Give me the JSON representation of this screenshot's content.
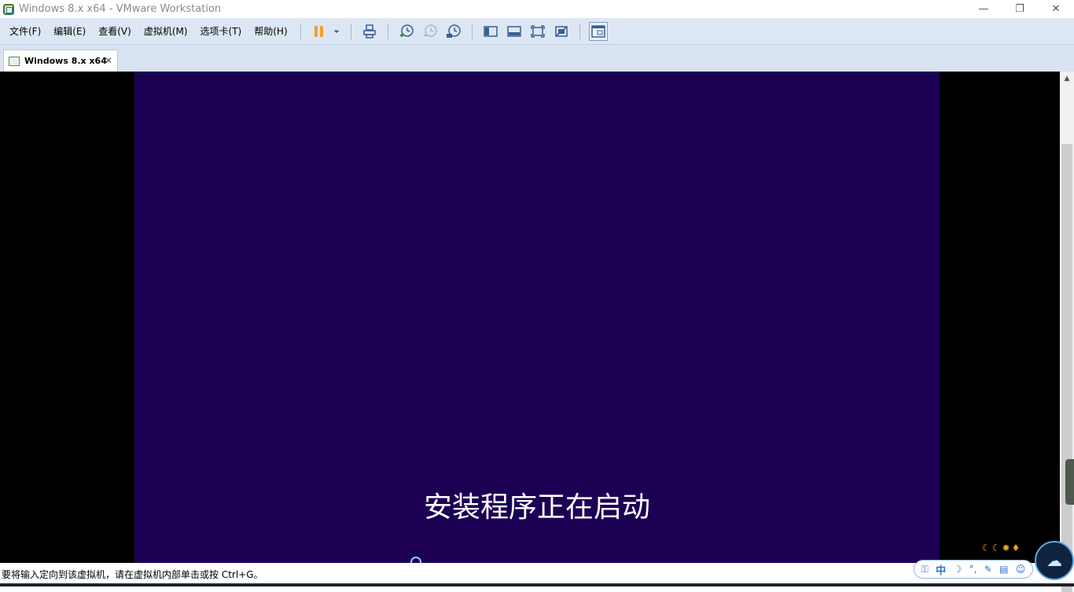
{
  "window": {
    "title": "Windows 8.x x64 - VMware Workstation",
    "minimize_glyph": "—",
    "restore_glyph": "❐",
    "close_glyph": "✕"
  },
  "menu": {
    "items": [
      "文件(F)",
      "编辑(E)",
      "查看(V)",
      "虚拟机(M)",
      "选项卡(T)",
      "帮助(H)"
    ]
  },
  "toolbar": {
    "icons": [
      "pause-icon",
      "dropdown-arrow-icon",
      "send-ctrl-alt-del-icon",
      "snapshot-take-icon",
      "snapshot-revert-icon",
      "snapshot-manager-icon",
      "show-library-icon",
      "thumbnail-bar-icon",
      "full-screen-icon",
      "unity-icon",
      "console-view-icon"
    ],
    "pause_color": "#f0a030",
    "icon_color": "#3a5f8f"
  },
  "tabs": [
    {
      "label": "Windows 8.x x64",
      "close_glyph": "✕"
    }
  ],
  "vm": {
    "screen_color": "#1c0054",
    "message": "安装程序正在启动"
  },
  "statusbar": {
    "text": "要将输入定向到该虚拟机，请在虚拟机内部单击或按 Ctrl+G。"
  },
  "tray": {
    "ime_language": "中",
    "ime_icons": [
      "lock-icon",
      "moon-icon",
      "punctuation-icon",
      "wrench-icon",
      "clipboard-icon",
      "smiley-icon"
    ],
    "weather_icons": [
      "moon-icon",
      "moon-icon",
      "sun-icon",
      "gem-icon"
    ]
  }
}
